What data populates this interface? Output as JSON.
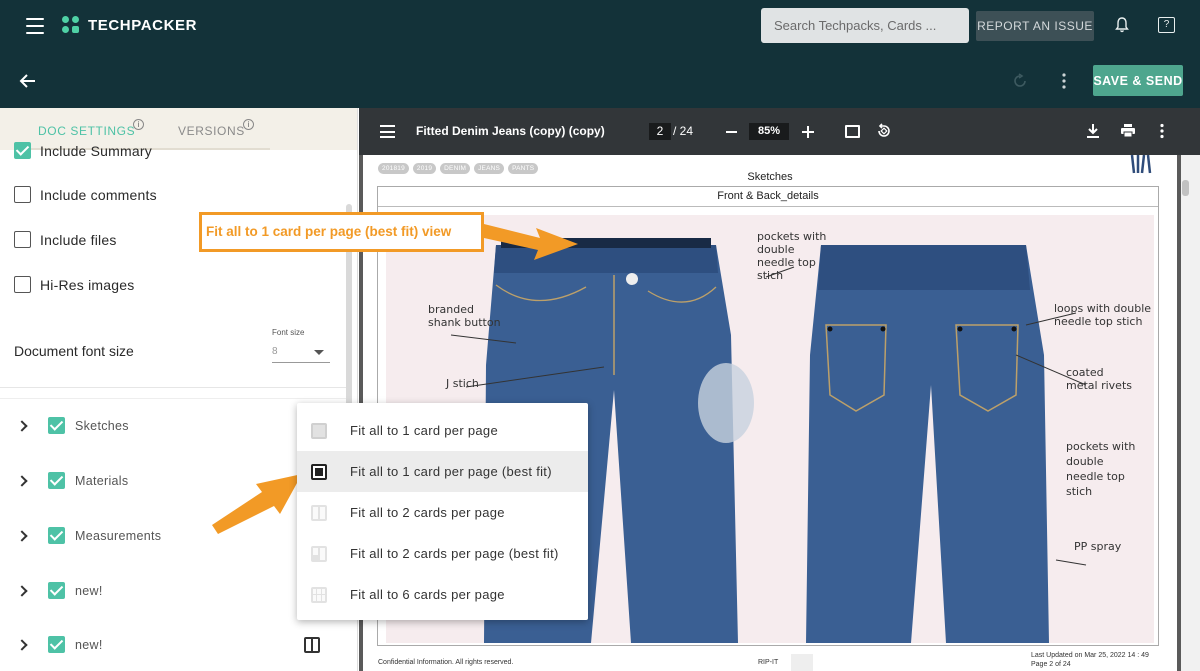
{
  "app": {
    "name": "TECHPACKER"
  },
  "topbar": {
    "search_placeholder": "Search Techpacks, Cards ...",
    "report_label": "REPORT AN ISSUE",
    "help_icon_glyph": "?"
  },
  "subbar": {
    "save_label": "SAVE & SEND"
  },
  "tabs": {
    "doc_settings": "DOC SETTINGS",
    "versions": "VERSIONS",
    "info_glyph": "i"
  },
  "options": [
    {
      "label": "Include Summary",
      "checked": true
    },
    {
      "label": "Include comments",
      "checked": false
    },
    {
      "label": "Include files",
      "checked": false
    },
    {
      "label": "Hi-Res images",
      "checked": false
    }
  ],
  "font_size": {
    "label": "Document font size",
    "small_label": "Font size",
    "value": "8"
  },
  "sections": [
    {
      "label": "Sketches",
      "checked": true
    },
    {
      "label": "Materials",
      "checked": true
    },
    {
      "label": "Measurements",
      "checked": true
    },
    {
      "label": "new!",
      "checked": true
    },
    {
      "label": "new!",
      "checked": true
    }
  ],
  "viewer": {
    "doc_title": "Fitted Denim Jeans (copy) (copy)",
    "current_page": "2",
    "total_pages": "/ 24",
    "zoom": "85%"
  },
  "page": {
    "tags": [
      "201819",
      "2019",
      "DENIM",
      "JEANS",
      "PANTS"
    ],
    "title": "Sketches",
    "card_title": "Front & Back_details",
    "sketch_labels": {
      "pockets": [
        "pockets with",
        "double",
        "needle top",
        "stich"
      ],
      "branded": [
        "branded",
        "shank button"
      ],
      "jstich": [
        "J stich"
      ],
      "loops": [
        "loops with double",
        "needle top stich"
      ],
      "rivets": [
        "coated",
        "metal rivets"
      ],
      "back_pockets": [
        "pockets with",
        "double",
        "needle top",
        "stich"
      ],
      "spray": [
        "PP spray"
      ]
    },
    "footer_left": "Confidential Information. All rights reserved.",
    "footer_center": "RIP-IT",
    "footer_updated": "Last Updated on Mar 25, 2022 14 : 49",
    "footer_page": "Page 2 of 24"
  },
  "annotation": {
    "callout": "Fit all to 1 card per page (best fit) view"
  },
  "fit_menu": [
    {
      "label": "Fit all to 1 card per page",
      "icon": "single-card-icon",
      "selected": false
    },
    {
      "label": "Fit all to 1 card per page (best fit)",
      "icon": "single-card-bestfit-icon",
      "selected": true
    },
    {
      "label": "Fit all to 2 cards per page",
      "icon": "two-cards-icon",
      "selected": false
    },
    {
      "label": "Fit all to 2 cards per page (best fit)",
      "icon": "two-cards-bestfit-icon",
      "selected": false
    },
    {
      "label": "Fit all to 6 cards per page",
      "icon": "six-cards-icon",
      "selected": false
    }
  ],
  "colors": {
    "nav": "#133239",
    "accent": "#4ec2a6",
    "save": "#4ea68e",
    "annotation": "#f29a26",
    "denim": "#3a5f93"
  }
}
